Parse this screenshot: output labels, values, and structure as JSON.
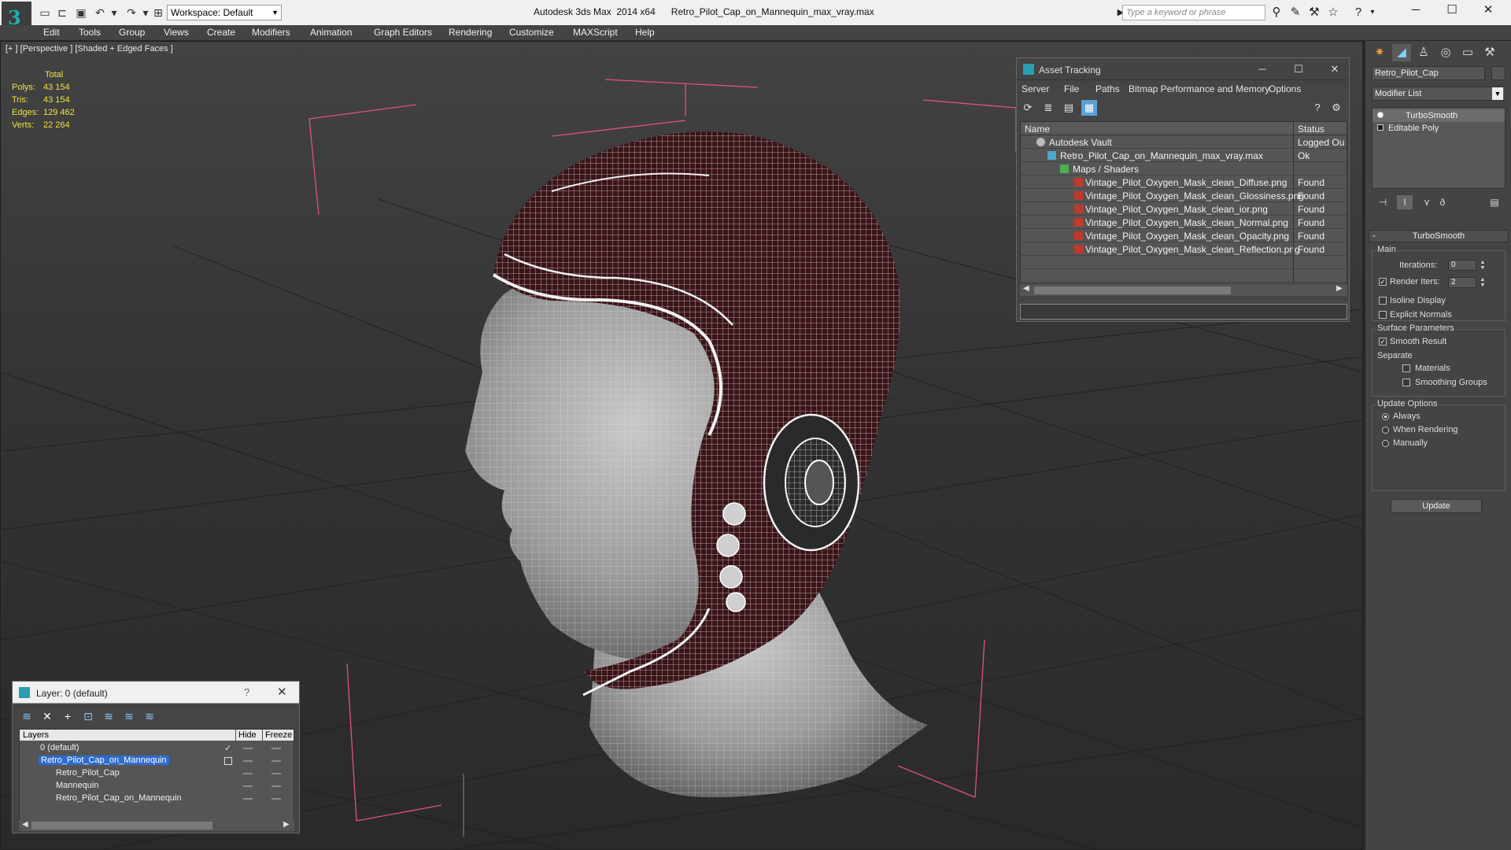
{
  "titlebar": {
    "workspace": "Workspace: Default",
    "app_title": "Autodesk 3ds Max  2014 x64",
    "file_title": "Retro_Pilot_Cap_on_Mannequin_max_vray.max",
    "search_placeholder": "Type a keyword or phrase"
  },
  "menu": [
    "Edit",
    "Tools",
    "Group",
    "Views",
    "Create",
    "Modifiers",
    "Animation",
    "Graph Editors",
    "Rendering",
    "Customize",
    "MAXScript",
    "Help"
  ],
  "viewport": {
    "label": "[+ ] [Perspective ] [Shaded + Edged Faces ]",
    "stats": {
      "total_label": "Total",
      "rows": [
        {
          "label": "Polys:",
          "value": "43 154"
        },
        {
          "label": "Tris:",
          "value": "43 154"
        },
        {
          "label": "Edges:",
          "value": "129 462"
        },
        {
          "label": "Verts:",
          "value": "22 264"
        }
      ]
    }
  },
  "asset_tracking": {
    "title": "Asset Tracking",
    "menu": [
      "Server",
      "File",
      "Paths",
      "Bitmap Performance and Memory",
      "Options"
    ],
    "col_name": "Name",
    "col_status": "Status",
    "rows": [
      {
        "name": "Autodesk Vault",
        "status": "Logged Ou"
      },
      {
        "name": "Retro_Pilot_Cap_on_Mannequin_max_vray.max",
        "status": "Ok"
      },
      {
        "name": "Maps / Shaders",
        "status": ""
      },
      {
        "name": "Vintage_Pilot_Oxygen_Mask_clean_Diffuse.png",
        "status": "Found"
      },
      {
        "name": "Vintage_Pilot_Oxygen_Mask_clean_Glossiness.png",
        "status": "Found"
      },
      {
        "name": "Vintage_Pilot_Oxygen_Mask_clean_ior.png",
        "status": "Found"
      },
      {
        "name": "Vintage_Pilot_Oxygen_Mask_clean_Normal.png",
        "status": "Found"
      },
      {
        "name": "Vintage_Pilot_Oxygen_Mask_clean_Opacity.png",
        "status": "Found"
      },
      {
        "name": "Vintage_Pilot_Oxygen_Mask_clean_Reflection.png",
        "status": "Found"
      }
    ]
  },
  "layer_window": {
    "title": "Layer: 0 (default)",
    "help": "?",
    "col_layers": "Layers",
    "col_hide": "Hide",
    "col_freeze": "Freeze",
    "rows": [
      {
        "name": "0 (default)"
      },
      {
        "name": "Retro_Pilot_Cap_on_Mannequin"
      },
      {
        "name": "Retro_Pilot_Cap"
      },
      {
        "name": "Mannequin"
      },
      {
        "name": "Retro_Pilot_Cap_on_Mannequin"
      }
    ]
  },
  "command_panel": {
    "object_name": "Retro_Pilot_Cap",
    "modifier_list": "Modifier List",
    "stack": [
      "TurboSmooth",
      "Editable Poly"
    ],
    "turbosmooth": {
      "header": "TurboSmooth",
      "main_label": "Main",
      "iterations_label": "Iterations:",
      "iterations_value": "0",
      "render_iters_label": "Render Iters:",
      "render_iters_value": "2",
      "isoline_label": "Isoline Display",
      "explicit_label": "Explicit Normals",
      "surface_label": "Surface Parameters",
      "smooth_result_label": "Smooth Result",
      "separate_label": "Separate",
      "materials_label": "Materials",
      "smoothing_groups_label": "Smoothing Groups",
      "update_options_label": "Update Options",
      "always_label": "Always",
      "when_rendering_label": "When Rendering",
      "manually_label": "Manually",
      "update_button": "Update"
    }
  },
  "colors": {
    "accent": "#2e6bd0",
    "stats_yellow": "#f0e040",
    "helmet_leather": "#3a1418",
    "gizmo_pink": "#e0508a"
  }
}
